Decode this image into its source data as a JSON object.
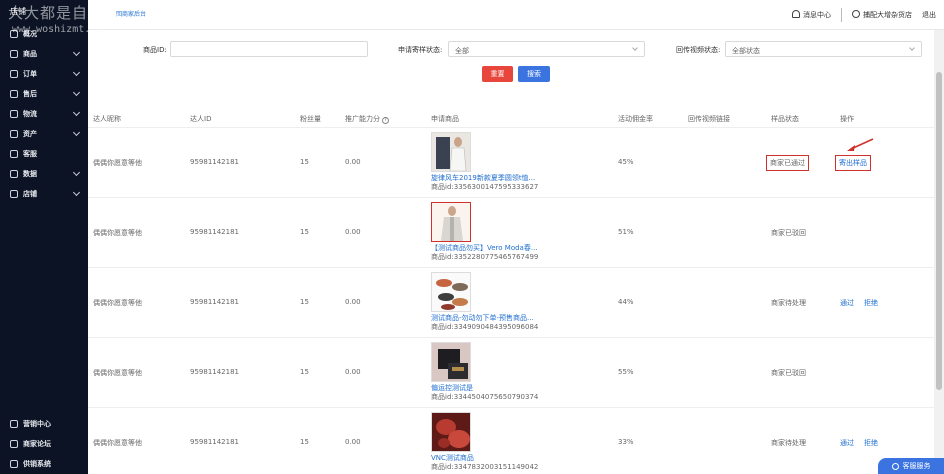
{
  "sidebar": {
    "header": "店铺",
    "header_link": "回商家后台",
    "items": [
      {
        "label": "概况",
        "has_chevron": false
      },
      {
        "label": "商品",
        "has_chevron": true
      },
      {
        "label": "订单",
        "has_chevron": true
      },
      {
        "label": "售后",
        "has_chevron": true
      },
      {
        "label": "物流",
        "has_chevron": true
      },
      {
        "label": "资产",
        "has_chevron": true
      },
      {
        "label": "客服",
        "has_chevron": false
      },
      {
        "label": "数据",
        "has_chevron": true
      },
      {
        "label": "店铺",
        "has_chevron": true
      }
    ],
    "bottom_items": [
      "营销中心",
      "商家论坛",
      "供销系统"
    ]
  },
  "watermark": {
    "line1": "大大都是自媒体",
    "line2": "www.woshizmt.cn"
  },
  "topbar": {
    "messages": "消息中心",
    "user": "捕配大增杂货店",
    "logout": "退出"
  },
  "filters": {
    "product_id_label": "商品ID:",
    "product_id_value": "",
    "apply_status_label": "申请寄样状态:",
    "apply_status_value": "全部",
    "video_status_label": "回传视频状态:",
    "video_status_value": "全部状态",
    "reset_label": "重置",
    "search_label": "搜索"
  },
  "table": {
    "columns": [
      "达人昵称",
      "达人ID",
      "粉丝量",
      "推广能力分",
      "申请商品",
      "活动佣金率",
      "回传视频链接",
      "样品状态",
      "操作"
    ],
    "rows": [
      {
        "nickname": "偶偶你愿意等他",
        "id": "95981142181",
        "fans": "15",
        "score": "0.00",
        "product_name": "旋律风车2019新款夏季圆领t恤...",
        "product_id": "商品id:3356300147595333627",
        "commission": "45%",
        "status": "商家已通过",
        "actions": [
          "寄出样品"
        ],
        "status_boxed": true,
        "thumb": "dress"
      },
      {
        "nickname": "偶偶你愿意等他",
        "id": "95981142181",
        "fans": "15",
        "score": "0.00",
        "product_name": "【测试商品勿买】Vero Moda春...",
        "product_id": "商品id:3352280775465767499",
        "commission": "51%",
        "status": "商家已驳回",
        "actions": [],
        "status_boxed": false,
        "thumb": "coat"
      },
      {
        "nickname": "偶偶你愿意等他",
        "id": "95981142181",
        "fans": "15",
        "score": "0.00",
        "product_name": "测试商品-勿动勿下单-预售商品...",
        "product_id": "商品id:3349090484395096084",
        "commission": "44%",
        "status": "商家待处理",
        "actions": [
          "通过",
          "拒绝"
        ],
        "status_boxed": false,
        "thumb": "shoes"
      },
      {
        "nickname": "偶偶你愿意等他",
        "id": "95981142181",
        "fans": "15",
        "score": "0.00",
        "product_name": "偏运控测试是",
        "product_id": "商品id:3344504075650790374",
        "commission": "55%",
        "status": "商家已驳回",
        "actions": [],
        "status_boxed": false,
        "thumb": "box"
      },
      {
        "nickname": "偶偶你愿意等他",
        "id": "95981142181",
        "fans": "15",
        "score": "0.00",
        "product_name": "VNC测试商品",
        "product_id": "商品id:3347832003151149042",
        "commission": "33%",
        "status": "商家待处理",
        "actions": [
          "通过",
          "拒绝"
        ],
        "status_boxed": false,
        "thumb": "red"
      }
    ]
  },
  "customer_service": "客服服务",
  "colors": {
    "sidebar_bg": "#0c1324",
    "primary": "#3b74e0",
    "danger": "#e8453c",
    "link": "#1f6fd1",
    "highlight": "#d0312d"
  }
}
